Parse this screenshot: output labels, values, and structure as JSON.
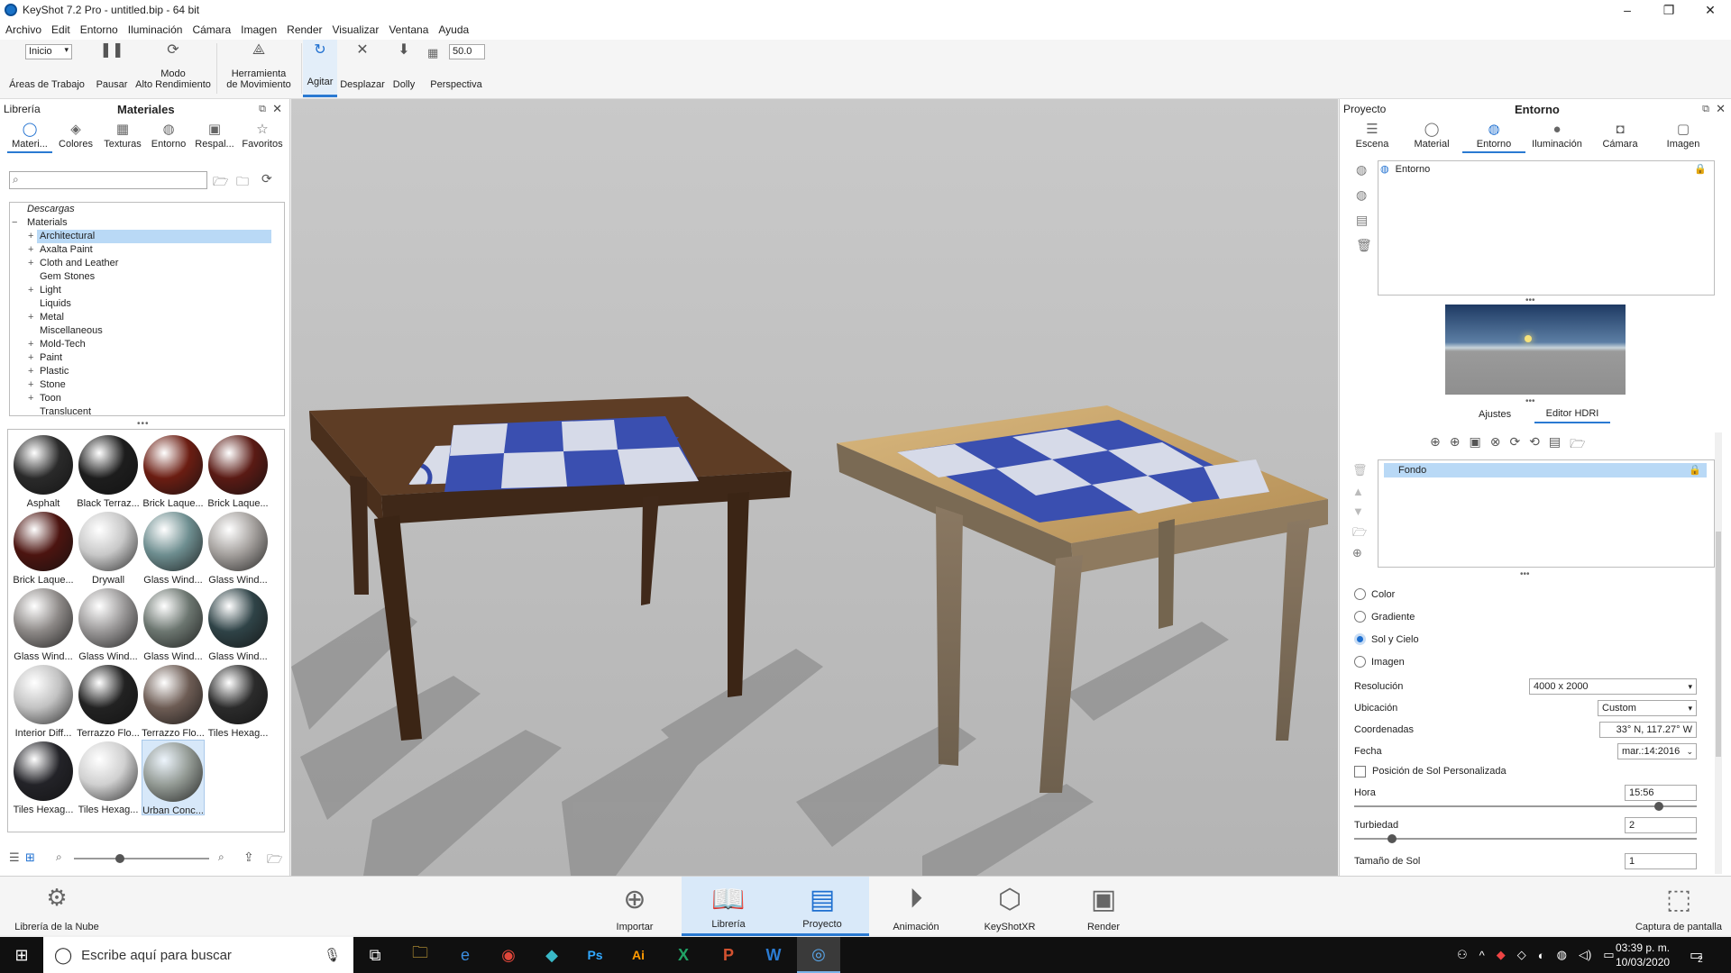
{
  "window": {
    "title": "KeyShot 7.2 Pro  - untitled.bip  - 64 bit",
    "minimize": "–",
    "maximize": "❐",
    "close": "✕"
  },
  "menu": [
    "Archivo",
    "Edit",
    "Entorno",
    "Iluminación",
    "Cámara",
    "Imagen",
    "Render",
    "Visualizar",
    "Ventana",
    "Ayuda"
  ],
  "toolbar": {
    "workspace_value": "Inicio",
    "workspace_label": "Áreas de Trabajo",
    "pause_label": "Pausar",
    "perf_label_1": "Modo",
    "perf_label_2": "Alto Rendimiento",
    "move_tool_1": "Herramienta",
    "move_tool_2": "de Movimiento",
    "tumble_label": "Agitar",
    "pan_label": "Desplazar",
    "dolly_label": "Dolly",
    "fov_value": "50.0",
    "perspective_label": "Perspectiva"
  },
  "library": {
    "panel_title": "Librería",
    "panel_subtitle": "Materiales",
    "tabs": [
      "Materi...",
      "Colores",
      "Texturas",
      "Entorno",
      "Respal...",
      "Favoritos"
    ],
    "search_placeholder": "",
    "tree": {
      "downloads": "Descargas",
      "root": "Materials",
      "items": [
        "Architectural",
        "Axalta Paint",
        "Cloth and Leather",
        "Gem Stones",
        "Light",
        "Liquids",
        "Metal",
        "Miscellaneous",
        "Mold-Tech",
        "Paint",
        "Plastic",
        "Stone",
        "Toon",
        "Translucent"
      ]
    },
    "thumbnails": [
      {
        "label": "Asphalt",
        "color": "#2a2a2a"
      },
      {
        "label": "Black Terraz...",
        "color": "#1d1d1d"
      },
      {
        "label": "Brick Laque...",
        "color": "#6b1d12"
      },
      {
        "label": "Brick Laque...",
        "color": "#5a1a14"
      },
      {
        "label": "Brick Laque...",
        "color": "#4c1410"
      },
      {
        "label": "Drywall",
        "color": "#c8c8c8"
      },
      {
        "label": "Glass Wind...",
        "color": "#6e8e90"
      },
      {
        "label": "Glass Wind...",
        "color": "#a4a09d"
      },
      {
        "label": "Glass Wind...",
        "color": "#8d8987"
      },
      {
        "label": "Glass Wind...",
        "color": "#9a9898"
      },
      {
        "label": "Glass Wind...",
        "color": "#6c7670"
      },
      {
        "label": "Glass Wind...",
        "color": "#2f4347"
      },
      {
        "label": "Interior Diff...",
        "color": "#c2c2c2"
      },
      {
        "label": "Terrazzo Flo...",
        "color": "#222222"
      },
      {
        "label": "Terrazzo Flo...",
        "color": "#6d5c54"
      },
      {
        "label": "Tiles Hexag...",
        "color": "#2b2b2b"
      },
      {
        "label": "Tiles Hexag...",
        "color": "#232328"
      },
      {
        "label": "Tiles Hexag...",
        "color": "#d0d0d0"
      },
      {
        "label": "Urban Conc...",
        "color": "#939a94"
      }
    ]
  },
  "project": {
    "panel_title": "Proyecto",
    "panel_subtitle": "Entorno",
    "tabs": [
      "Escena",
      "Material",
      "Entorno",
      "Iluminación",
      "Cámara",
      "Imagen"
    ],
    "env_list": [
      "Entorno"
    ],
    "subtabs": [
      "Ajustes",
      "Editor HDRI"
    ],
    "layers": [
      "Fondo"
    ],
    "background_options": [
      "Color",
      "Gradiente",
      "Sol y Cielo",
      "Imagen"
    ],
    "background_selected": "Sol y Cielo",
    "resolution_label": "Resolución",
    "resolution_value": "4000 x 2000",
    "location_label": "Ubicación",
    "location_value": "Custom",
    "coords_label": "Coordenadas",
    "coords_value": "33° N, 117.27° W",
    "date_label": "Fecha",
    "date_value": "mar.:14:2016",
    "custom_sun_label": "Posición de Sol Personalizada",
    "hour_label": "Hora",
    "hour_value": "15:56",
    "hour_slider": 0.9,
    "turbidity_label": "Turbiedad",
    "turbidity_value": "2",
    "turbidity_slider": 0.1,
    "sun_size_label": "Tamaño de Sol",
    "sun_size_value": "1"
  },
  "bottom": {
    "cloud_library": "Librería de la Nube",
    "buttons": [
      "Importar",
      "Librería",
      "Proyecto",
      "Animación",
      "KeyShotXR",
      "Render"
    ],
    "screenshot": "Captura de pantalla"
  },
  "taskbar": {
    "search_placeholder": "Escribe aquí para buscar",
    "time": "03:39 p. m.",
    "date": "10/03/2020",
    "notifications": "2"
  }
}
